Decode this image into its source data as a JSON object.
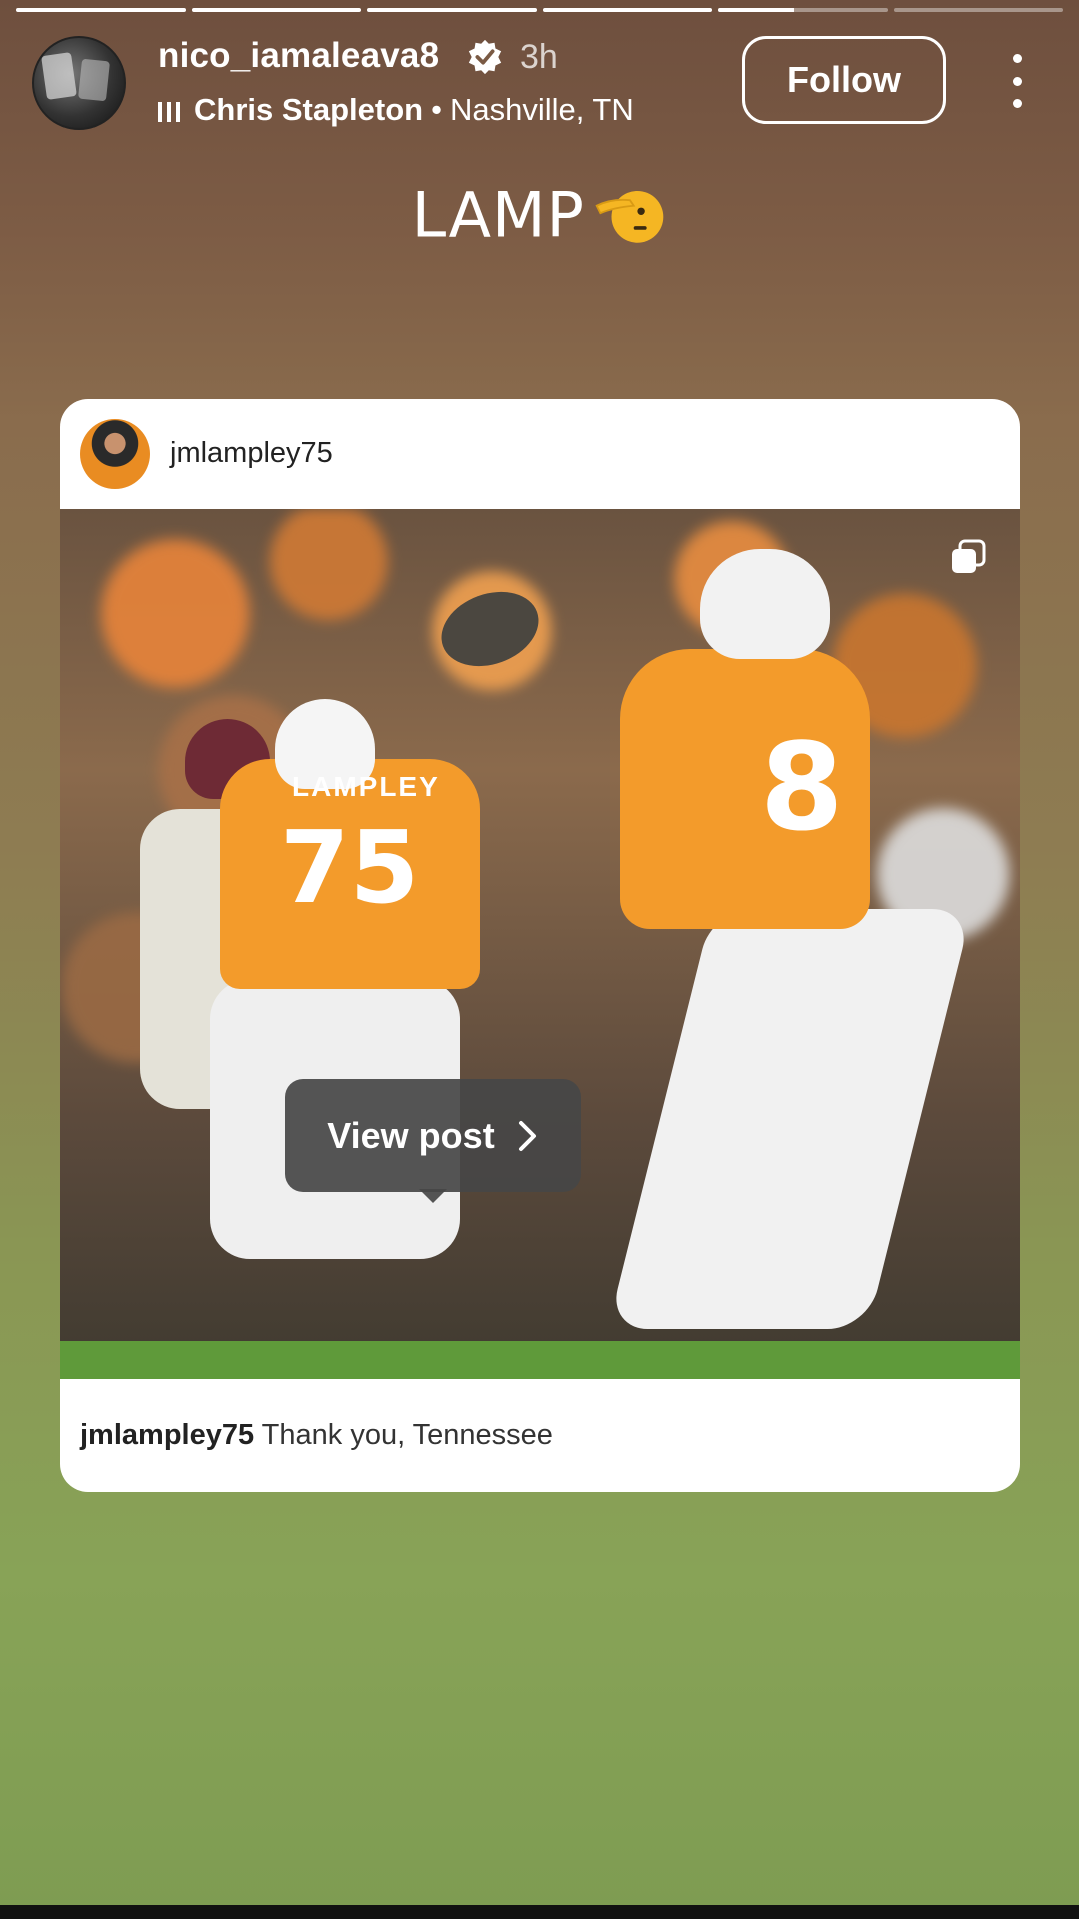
{
  "story": {
    "progress": [
      1,
      1,
      1,
      1,
      0.45,
      0
    ],
    "username": "nico_iamaleava8",
    "verified": true,
    "time": "3h",
    "music_artist": "Chris Stapleton",
    "location": "Nashville, TN",
    "separator": "•",
    "follow_label": "Follow",
    "sticker_text": "LAMP"
  },
  "shared_post": {
    "username": "jmlampley75",
    "photo_numbers": {
      "qb": "8",
      "lineman": "75",
      "lineman_name": "LAMPLEY"
    },
    "caption_user": "jmlampley75",
    "caption_text": "Thank you, Tennessee",
    "view_post_label": "View post"
  }
}
